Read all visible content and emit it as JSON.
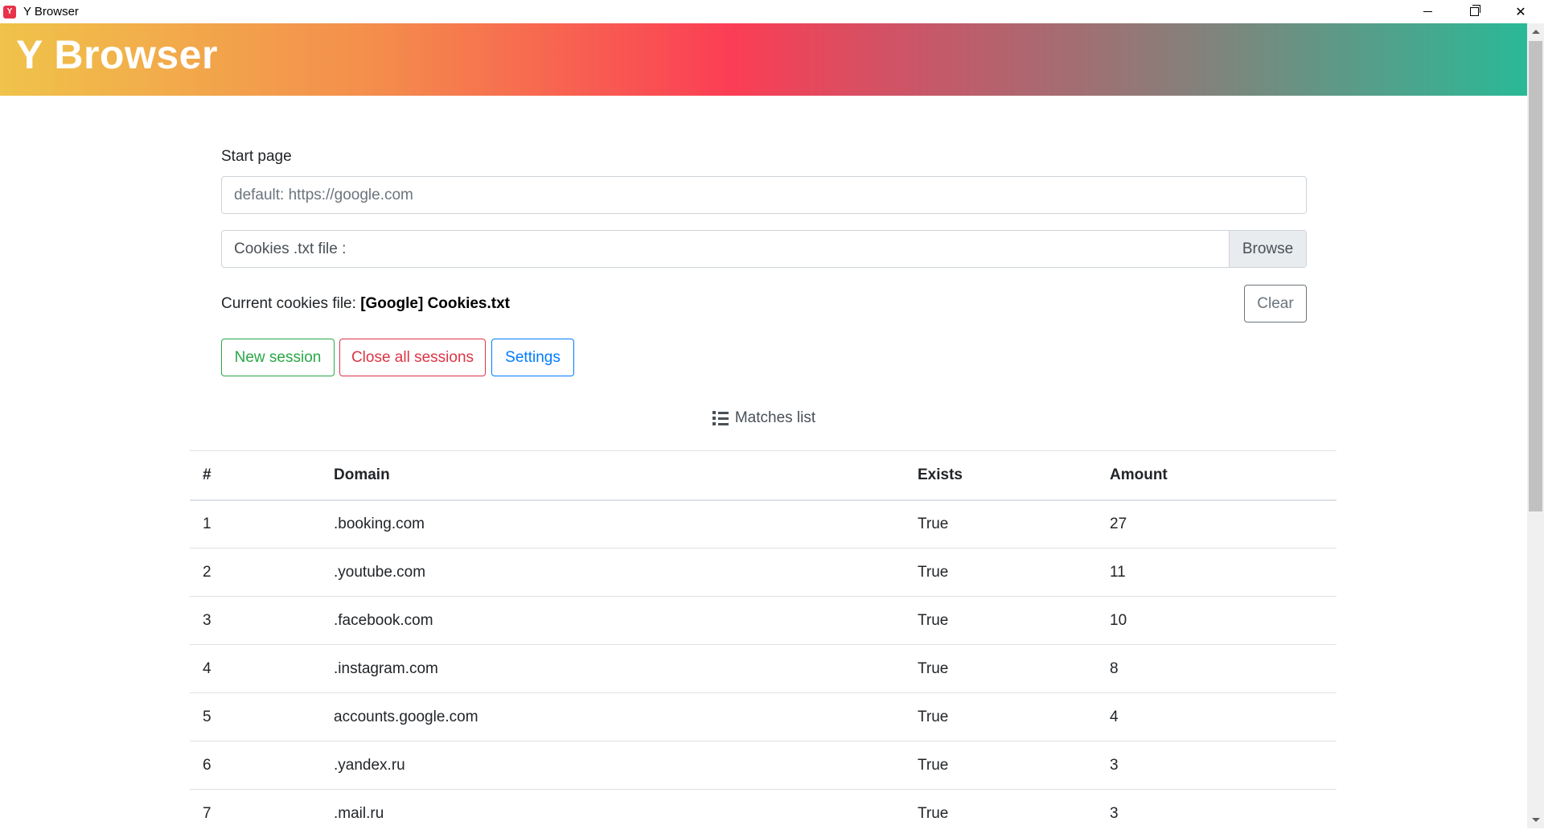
{
  "window": {
    "title": "Y Browser",
    "icon_letter": "Y",
    "controls": {
      "minimize": "minimize",
      "maximize": "maximize",
      "close": "✕"
    }
  },
  "header": {
    "title": "Y Browser",
    "gradient_colors": [
      "#f0c34a",
      "#f48c4c",
      "#fb3d55",
      "#c25a6a",
      "#86807a",
      "#2ab997"
    ]
  },
  "form": {
    "start_page_label": "Start page",
    "start_page_placeholder": "default: https://google.com",
    "start_page_value": "",
    "cookies_file_label": "Cookies .txt file :",
    "browse_label": "Browse",
    "current_cookies_prefix": "Current cookies file:",
    "current_cookies_file": "[Google] Cookies.txt",
    "clear_label": "Clear"
  },
  "actions": {
    "new_session": "New session",
    "close_all_sessions": "Close all sessions",
    "settings": "Settings"
  },
  "colors": {
    "success": "#28a745",
    "danger": "#dc3545",
    "primary": "#007bff",
    "secondary": "#6c757d"
  },
  "matches": {
    "heading": "Matches list",
    "icon": "list-icon",
    "columns": [
      "#",
      "Domain",
      "Exists",
      "Amount"
    ],
    "rows": [
      {
        "num": "1",
        "domain": ".booking.com",
        "exists": "True",
        "amount": "27"
      },
      {
        "num": "2",
        "domain": ".youtube.com",
        "exists": "True",
        "amount": "11"
      },
      {
        "num": "3",
        "domain": ".facebook.com",
        "exists": "True",
        "amount": "10"
      },
      {
        "num": "4",
        "domain": ".instagram.com",
        "exists": "True",
        "amount": "8"
      },
      {
        "num": "5",
        "domain": "accounts.google.com",
        "exists": "True",
        "amount": "4"
      },
      {
        "num": "6",
        "domain": ".yandex.ru",
        "exists": "True",
        "amount": "3"
      },
      {
        "num": "7",
        "domain": ".mail.ru",
        "exists": "True",
        "amount": "3"
      }
    ]
  }
}
